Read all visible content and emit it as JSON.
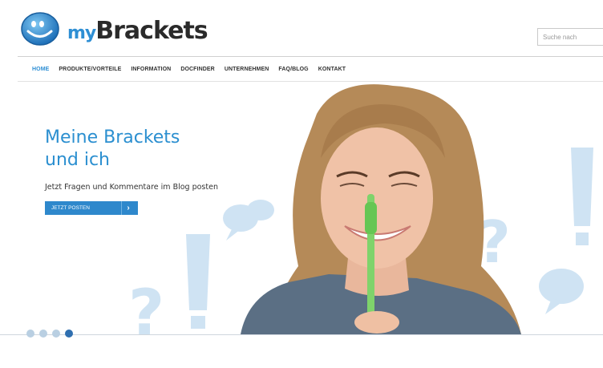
{
  "brand": {
    "logo_my": "my",
    "logo_brackets": "Brackets"
  },
  "search": {
    "placeholder": "Suche nach"
  },
  "nav": {
    "items": [
      {
        "label": "HOME"
      },
      {
        "label": "PRODUKTE/VORTEILE"
      },
      {
        "label": "INFORMATION"
      },
      {
        "label": "DOCFINDER"
      },
      {
        "label": "UNTERNEHMEN"
      },
      {
        "label": "FAQ/BLOG"
      },
      {
        "label": "KONTAKT"
      }
    ],
    "active_index": 0
  },
  "hero": {
    "title_line1": "Meine Brackets",
    "title_line2": "und ich",
    "subtitle": "Jetzt Fragen und Kommentare im Blog posten",
    "cta_label": "JETZT POSTEN"
  },
  "slider": {
    "dot_count": 4,
    "active_dot": 4
  },
  "colors": {
    "accent": "#2e8fd4",
    "decor": "#cfe3f3",
    "button": "#2e88cc"
  },
  "icons": [
    "smiley-logo-icon",
    "speech-bubble-icon",
    "question-mark-icon",
    "exclamation-mark-icon",
    "chevron-right-icon"
  ]
}
